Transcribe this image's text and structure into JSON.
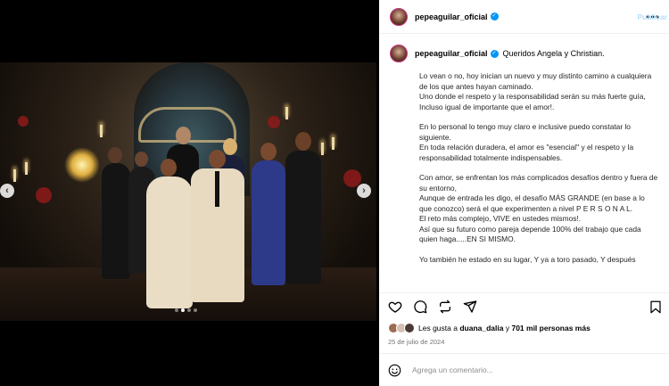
{
  "post": {
    "username": "pepeaguilar_oficial",
    "greeting": "Queridos Angela y Christian.",
    "paragraphs": [
      "Lo vean o no, hoy inician un nuevo y muy distinto camino a cualquiera de los que antes hayan caminado.\nUno donde el respeto y la responsabilidad serán su más fuerte guía,\nIncluso igual de importante que el amor!.",
      "En lo personal lo tengo muy claro e inclusive puedo constatar lo siguiente.\nEn toda relación duradera, el amor es \"esencial\" y el respeto y la responsabilidad totalmente indispensables.",
      "Con amor, se enfrentan los más complicados desafíos dentro y fuera de su entorno,\nAunque de entrada les digo, el desafío MÁS GRANDE (en base a lo que conozco) será el que experimenten a nivel P E R S O N A L.\nEl reto más complejo, VIVE en ustedes mismos!.\nAsí que su futuro como pareja depende 100% del trabajo que cada quien haga.....EN SI MISMO.",
      "Yo también he estado en su lugar, Y ya a toro pasado, Y después"
    ],
    "likes_prefix": "Les gusta a",
    "likes_user": "duana_dalia",
    "likes_conjunction": "y",
    "likes_count": "701 mil personas más",
    "date": "25 de julio de 2024"
  },
  "comment": {
    "placeholder": "Agrega un comentario...",
    "publish_label": "Publicar"
  },
  "carousel": {
    "prev_glyph": "‹",
    "next_glyph": "›",
    "slides": 4,
    "active_slide": 2
  },
  "colors": {
    "verified": "#0095f6",
    "publish_disabled": "#b2dffc"
  }
}
